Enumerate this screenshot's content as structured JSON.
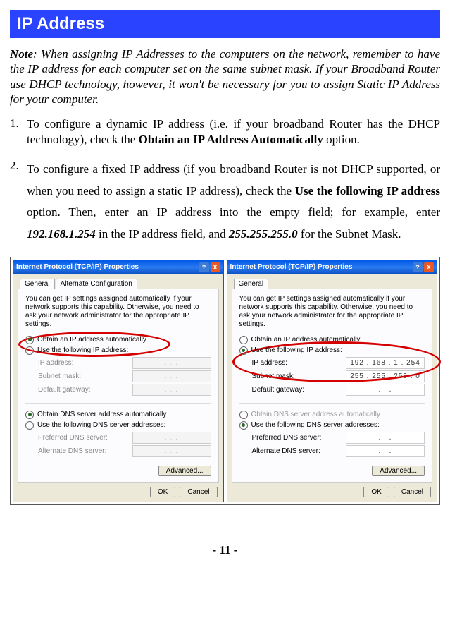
{
  "header": "IP Address",
  "note_label": "Note",
  "note_text": ": When assigning IP Addresses to the computers on the network, remember to have the IP address for each computer set on the same subnet mask. If your Broadband Router use DHCP technology, however, it won't be necessary for you to assign Static IP Address for your computer.",
  "items": [
    {
      "num": "1.",
      "pre": "To configure a dynamic IP address (i.e. if your broadband Router has the DHCP technology), check the ",
      "b1": "Obtain an IP Address Automatically",
      "post": " option."
    },
    {
      "num": "2.",
      "pre": "To configure a fixed IP address (if you broadband Router is not DHCP supported, or when you need to assign a static IP address), check the ",
      "b1": "Use the following IP address",
      "mid": " option. Then, enter an IP address into the empty field; for example, enter ",
      "bi1": "192.168.1.254",
      "mid2": " in the IP address field, and ",
      "bi2": "255.255.255.0",
      "post": " for the Subnet Mask."
    }
  ],
  "dialog": {
    "title": "Internet Protocol (TCP/IP) Properties",
    "help": "?",
    "close": "X",
    "tab_general": "General",
    "tab_alt": "Alternate Configuration",
    "desc": "You can get IP settings assigned automatically if your network supports this capability. Otherwise, you need to ask your network administrator for the appropriate IP settings.",
    "r_auto_ip": "Obtain an IP address automatically",
    "r_use_ip": "Use the following IP address:",
    "f_ip": "IP address:",
    "f_mask": "Subnet mask:",
    "f_gw": "Default gateway:",
    "r_auto_dns": "Obtain DNS server address automatically",
    "r_use_dns": "Use the following DNS server addresses:",
    "f_pdns": "Preferred DNS server:",
    "f_adns": "Alternate DNS server:",
    "adv": "Advanced...",
    "ok": "OK",
    "cancel": "Cancel",
    "ip_val": "192 . 168 .  1  . 254",
    "mask_val": "255 . 255 . 255 .  0",
    "dots": ".      .      ."
  },
  "page_num": "- 11 -"
}
